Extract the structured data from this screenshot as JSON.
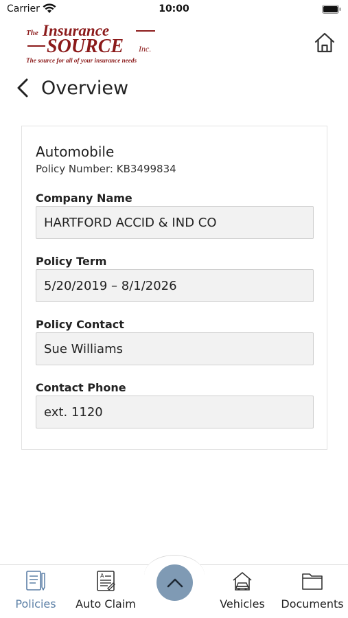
{
  "status_bar": {
    "carrier": "Carrier",
    "time": "10:00"
  },
  "header": {
    "logo": {
      "line1": "The Insurance —",
      "line2": "—SOURCE Inc.",
      "tagline": "The source for all of your insurance needs"
    },
    "home_icon": "home-icon",
    "back_icon": "chevron-left-icon",
    "title": "Overview"
  },
  "policy": {
    "type": "Automobile",
    "number_label": "Policy Number:",
    "number_value": "KB3499834",
    "fields": [
      {
        "label": "Company Name",
        "value": "HARTFORD ACCID & IND CO"
      },
      {
        "label": "Policy Term",
        "value": "5/20/2019 – 8/1/2026"
      },
      {
        "label": "Policy Contact",
        "value": "Sue Williams"
      },
      {
        "label": "Contact Phone",
        "value": "ext. 1120"
      }
    ]
  },
  "tab_bar": {
    "tabs": [
      {
        "label": "Policies",
        "icon": "policies-icon",
        "active": true
      },
      {
        "label": "Auto Claim",
        "icon": "auto-claim-icon",
        "active": false
      },
      {
        "label": "Vehicles",
        "icon": "vehicles-icon",
        "active": false
      },
      {
        "label": "Documents",
        "icon": "documents-icon",
        "active": false
      }
    ],
    "center_button_icon": "chevron-up-icon"
  },
  "colors": {
    "brand": "#8b1a1a",
    "accent": "#5b7fa6",
    "fab": "#7f9ab4",
    "field_bg": "#f2f2f2"
  }
}
